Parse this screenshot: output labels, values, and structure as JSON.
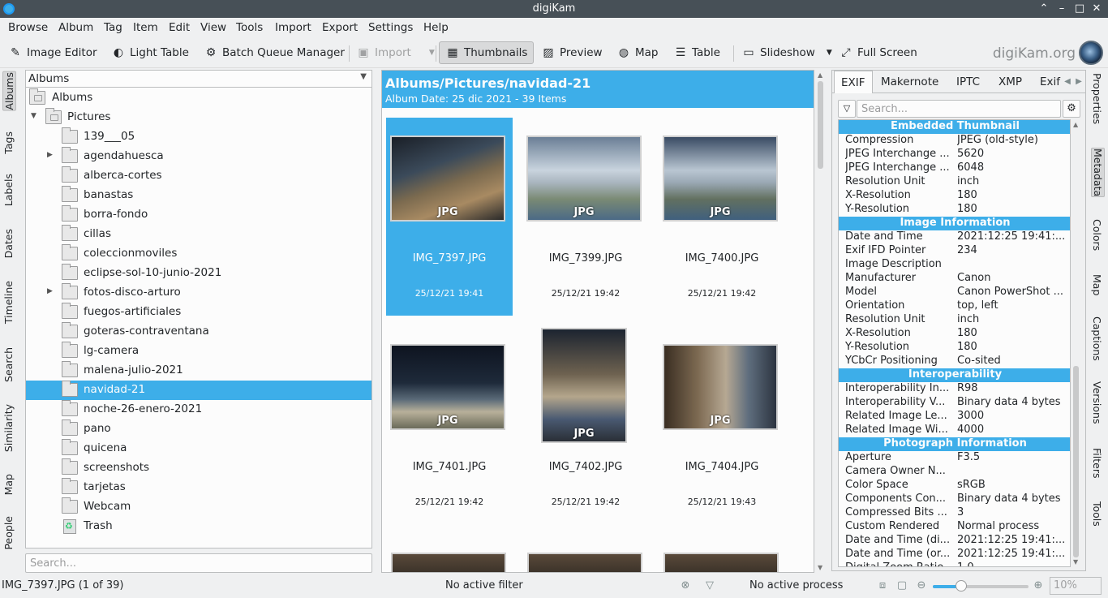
{
  "window": {
    "title": "digiKam"
  },
  "menu": [
    "Browse",
    "Album",
    "Tag",
    "Item",
    "Edit",
    "View",
    "Tools",
    "Import",
    "Export",
    "Settings",
    "Help"
  ],
  "toolbar": {
    "image_editor": "Image Editor",
    "light_table": "Light Table",
    "batch_queue": "Batch Queue Manager",
    "import": "Import",
    "thumbnails": "Thumbnails",
    "preview": "Preview",
    "map": "Map",
    "table": "Table",
    "slideshow": "Slideshow",
    "full_screen": "Full Screen",
    "brand": "digiKam.org"
  },
  "left_tabs": [
    "Albums",
    "Tags",
    "Labels",
    "Dates",
    "Timeline",
    "Search",
    "Similarity",
    "Map",
    "People"
  ],
  "album_panel": {
    "combo": "Albums",
    "root": "Albums",
    "pictures": "Pictures",
    "folders": [
      "139___05",
      "agendahuesca",
      "alberca-cortes",
      "banastas",
      "borra-fondo",
      "cillas",
      "coleccionmoviles",
      "eclipse-sol-10-junio-2021",
      "fotos-disco-arturo",
      "fuegos-artificiales",
      "goteras-contraventana",
      "lg-camera",
      "malena-julio-2021",
      "navidad-21",
      "noche-26-enero-2021",
      "pano",
      "quicena",
      "screenshots",
      "tarjetas",
      "Webcam"
    ],
    "trash": "Trash",
    "search_placeholder": "Search..."
  },
  "icon_view": {
    "path": "Albums/Pictures/navidad-21",
    "subtitle": "Album Date: 25 dic 2021 - 39 Items",
    "badge": "JPG",
    "items": [
      {
        "name": "IMG_7397.JPG",
        "date": "25/12/21 19:41"
      },
      {
        "name": "IMG_7399.JPG",
        "date": "25/12/21 19:42"
      },
      {
        "name": "IMG_7400.JPG",
        "date": "25/12/21 19:42"
      },
      {
        "name": "IMG_7401.JPG",
        "date": "25/12/21 19:42"
      },
      {
        "name": "IMG_7402.JPG",
        "date": "25/12/21 19:42"
      },
      {
        "name": "IMG_7404.JPG",
        "date": "25/12/21 19:43"
      }
    ]
  },
  "metadata": {
    "tabs": [
      "EXIF",
      "Makernote",
      "IPTC",
      "XMP",
      "Exif"
    ],
    "search_placeholder": "Search...",
    "sections": [
      {
        "title": "Embedded Thumbnail",
        "rows": [
          [
            "Compression",
            "JPEG (old-style)"
          ],
          [
            "JPEG Interchange ...",
            "5620"
          ],
          [
            "JPEG Interchange ...",
            "6048"
          ],
          [
            "Resolution Unit",
            "inch"
          ],
          [
            "X-Resolution",
            "180"
          ],
          [
            "Y-Resolution",
            "180"
          ]
        ]
      },
      {
        "title": "Image Information",
        "rows": [
          [
            "Date and Time",
            "2021:12:25 19:41:..."
          ],
          [
            "Exif IFD Pointer",
            "234"
          ],
          [
            "Image Description",
            ""
          ],
          [
            "Manufacturer",
            "Canon"
          ],
          [
            "Model",
            "Canon PowerShot ..."
          ],
          [
            "Orientation",
            "top, left"
          ],
          [
            "Resolution Unit",
            "inch"
          ],
          [
            "X-Resolution",
            "180"
          ],
          [
            "Y-Resolution",
            "180"
          ],
          [
            "YCbCr Positioning",
            "Co-sited"
          ]
        ]
      },
      {
        "title": "Interoperability",
        "rows": [
          [
            "Interoperability In...",
            "R98"
          ],
          [
            "Interoperability V...",
            "Binary data 4 bytes"
          ],
          [
            "Related Image Le...",
            "3000"
          ],
          [
            "Related Image Wi...",
            "4000"
          ]
        ]
      },
      {
        "title": "Photograph Information",
        "rows": [
          [
            "Aperture",
            "F3.5"
          ],
          [
            "Camera Owner N...",
            ""
          ],
          [
            "Color Space",
            "sRGB"
          ],
          [
            "Components Con...",
            "Binary data 4 bytes"
          ],
          [
            "Compressed Bits ...",
            "3"
          ],
          [
            "Custom Rendered",
            "Normal process"
          ],
          [
            "Date and Time (di...",
            "2021:12:25 19:41:..."
          ],
          [
            "Date and Time (or...",
            "2021:12:25 19:41:..."
          ],
          [
            "Digital Zoom Ratio",
            "1.0"
          ]
        ]
      }
    ]
  },
  "right_tabs": [
    "Properties",
    "Metadata",
    "Colors",
    "Map",
    "Captions",
    "Versions",
    "Filters",
    "Tools"
  ],
  "status": {
    "current": "IMG_7397.JPG (1 of 39)",
    "filter": "No active filter",
    "process": "No active process",
    "zoom": "10%",
    "zoom_level": 0.3
  },
  "colors": {
    "accent": "#3daee9",
    "titlebar": "#475057"
  }
}
